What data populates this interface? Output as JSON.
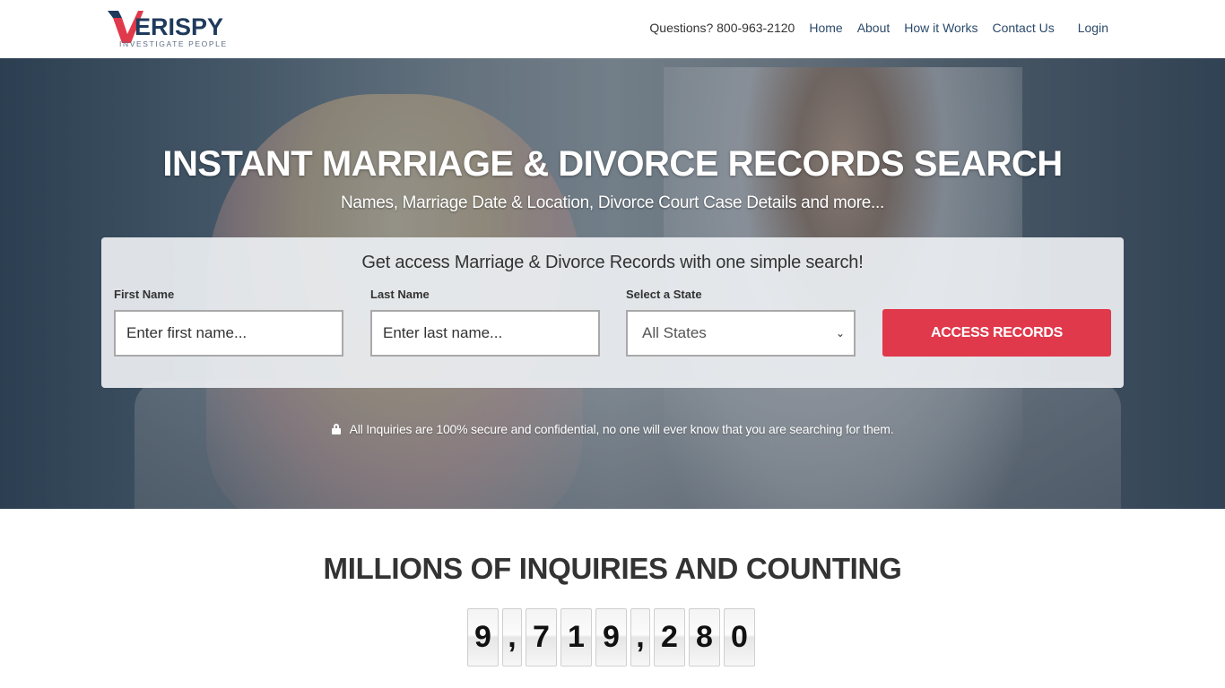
{
  "header": {
    "logo_text": "ERISPY",
    "logo_tagline": "INVESTIGATE PEOPLE",
    "phone": "Questions? 800-963-2120",
    "nav": [
      "Home",
      "About",
      "How it Works",
      "Contact Us"
    ],
    "login": "Login"
  },
  "hero": {
    "title": "INSTANT MARRIAGE & DIVORCE RECORDS SEARCH",
    "subtitle": "Names, Marriage Date & Location, Divorce Court Case Details and more...",
    "search": {
      "heading": "Get access Marriage & Divorce Records with one simple search!",
      "first_name_label": "First Name",
      "first_name_placeholder": "Enter first name...",
      "last_name_label": "Last Name",
      "last_name_placeholder": "Enter last name...",
      "state_label": "Select a State",
      "state_selected": "All States",
      "submit_label": "ACCESS RECORDS"
    },
    "secure_note": "All Inquiries are 100% secure and confidential, no one will ever know that you are searching for them."
  },
  "counter": {
    "title": "MILLIONS OF INQUIRIES AND COUNTING",
    "digits": [
      "9",
      ",",
      "7",
      "1",
      "9",
      ",",
      "2",
      "8",
      "0"
    ]
  },
  "colors": {
    "brand_navy": "#1f3a5c",
    "brand_red": "#e0394b",
    "nav_link": "#2b4a6b"
  }
}
